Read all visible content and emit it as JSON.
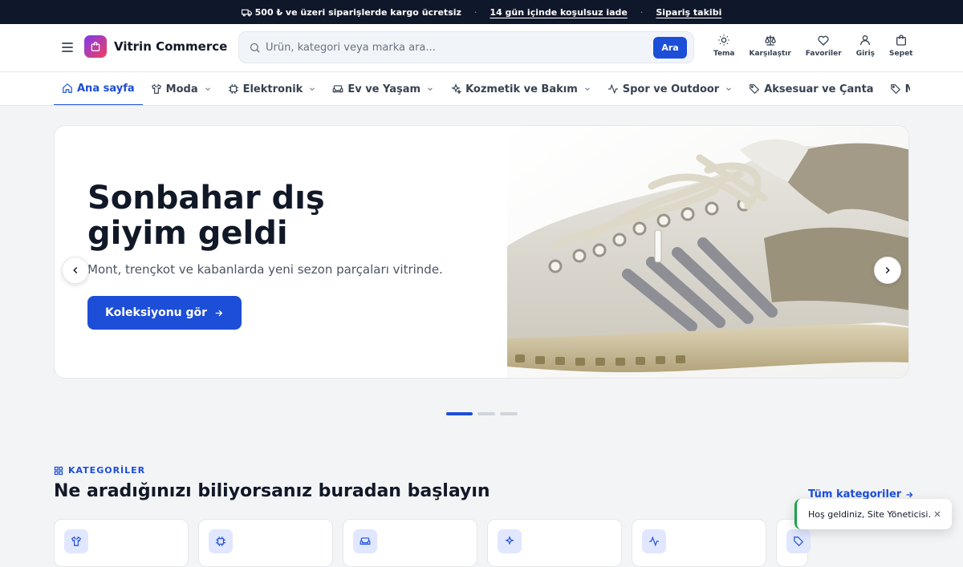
{
  "topbar": {
    "shipping": "500 ₺ ve üzeri siparişlerde kargo ücretsiz",
    "returns": "14 gün içinde koşulsuz iade",
    "tracking": "Sipariş takibi"
  },
  "header": {
    "brand": "Vitrin Commerce",
    "search_placeholder": "Ürün, kategori veya marka ara...",
    "search_button": "Ara",
    "actions": {
      "theme": "Tema",
      "compare": "Karşılaştır",
      "favorites": "Favoriler",
      "login": "Giriş",
      "cart": "Sepet"
    }
  },
  "nav": {
    "items": [
      {
        "label": "Ana sayfa",
        "icon": "home-icon",
        "active": true
      },
      {
        "label": "Moda",
        "icon": "shirt-icon"
      },
      {
        "label": "Elektronik",
        "icon": "chip-icon"
      },
      {
        "label": "Ev ve Yaşam",
        "icon": "sofa-icon"
      },
      {
        "label": "Kozmetik ve Bakım",
        "icon": "sparkles-icon"
      },
      {
        "label": "Spor ve Outdoor",
        "icon": "activity-icon"
      },
      {
        "label": "Aksesuar ve Çanta",
        "icon": "tag-icon"
      },
      {
        "label": "Mar",
        "icon": "tag-icon"
      }
    ]
  },
  "hero": {
    "title": "Sonbahar dış giyim geldi",
    "subtitle": "Mont, trençkot ve kabanlarda yeni sezon parçaları vitrinde.",
    "cta": "Koleksiyonu gör",
    "slide_count": 3,
    "active_slide": 1
  },
  "categories": {
    "kicker": "KATEGORİLER",
    "title": "Ne aradığınızı biliyorsanız buradan başlayın",
    "all_link": "Tüm kategoriler",
    "card_icons": [
      "shirt-icon",
      "chip-icon",
      "sofa-icon",
      "sparkles-icon",
      "activity-icon",
      "tag-icon"
    ]
  },
  "toast": {
    "message": "Hoş geldiniz, Site Yöneticisi."
  },
  "colors": {
    "accent": "#1d4ed8",
    "topbar": "#0f172a",
    "toast_border": "#16a34a"
  }
}
